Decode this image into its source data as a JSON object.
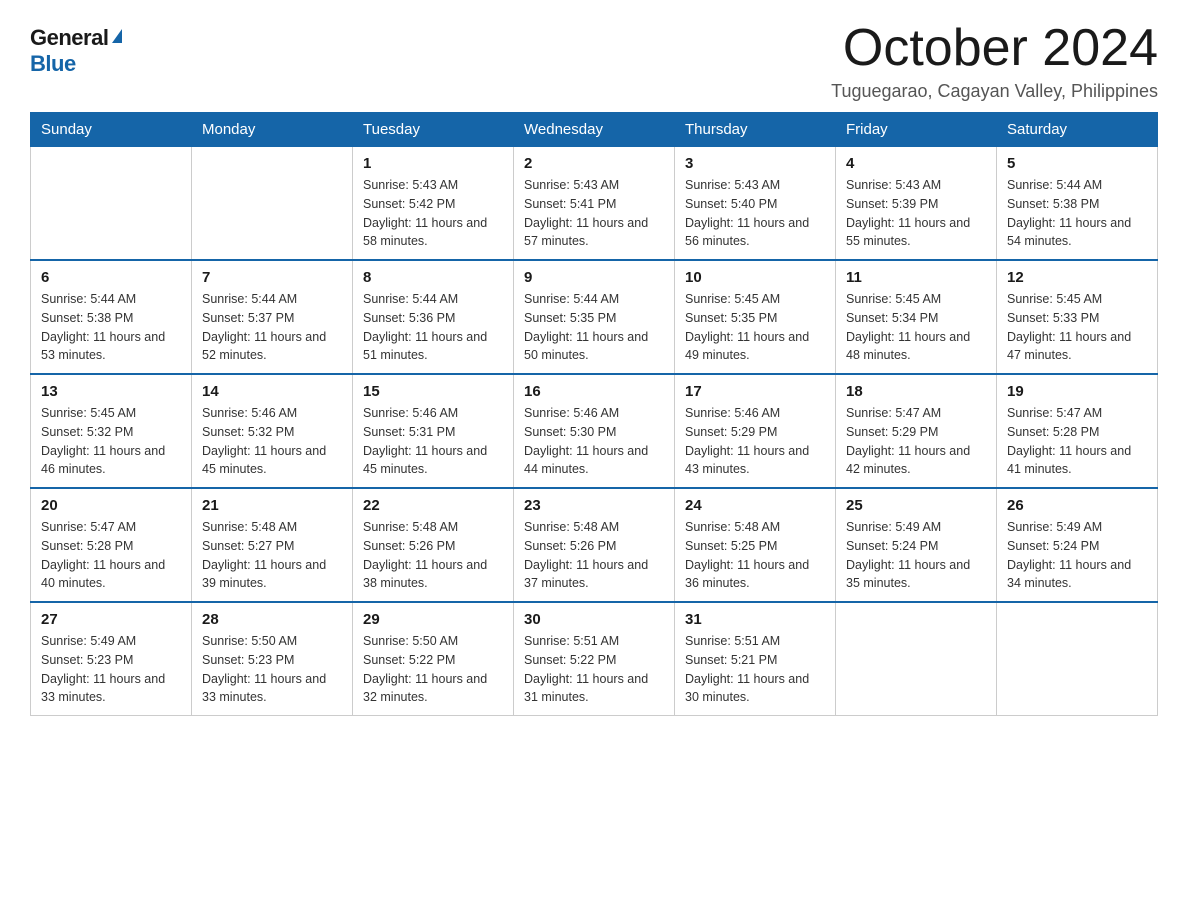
{
  "logo": {
    "general": "General",
    "blue": "Blue"
  },
  "title": "October 2024",
  "location": "Tuguegarao, Cagayan Valley, Philippines",
  "headers": [
    "Sunday",
    "Monday",
    "Tuesday",
    "Wednesday",
    "Thursday",
    "Friday",
    "Saturday"
  ],
  "weeks": [
    [
      {
        "day": "",
        "sunrise": "",
        "sunset": "",
        "daylight": ""
      },
      {
        "day": "",
        "sunrise": "",
        "sunset": "",
        "daylight": ""
      },
      {
        "day": "1",
        "sunrise": "Sunrise: 5:43 AM",
        "sunset": "Sunset: 5:42 PM",
        "daylight": "Daylight: 11 hours and 58 minutes."
      },
      {
        "day": "2",
        "sunrise": "Sunrise: 5:43 AM",
        "sunset": "Sunset: 5:41 PM",
        "daylight": "Daylight: 11 hours and 57 minutes."
      },
      {
        "day": "3",
        "sunrise": "Sunrise: 5:43 AM",
        "sunset": "Sunset: 5:40 PM",
        "daylight": "Daylight: 11 hours and 56 minutes."
      },
      {
        "day": "4",
        "sunrise": "Sunrise: 5:43 AM",
        "sunset": "Sunset: 5:39 PM",
        "daylight": "Daylight: 11 hours and 55 minutes."
      },
      {
        "day": "5",
        "sunrise": "Sunrise: 5:44 AM",
        "sunset": "Sunset: 5:38 PM",
        "daylight": "Daylight: 11 hours and 54 minutes."
      }
    ],
    [
      {
        "day": "6",
        "sunrise": "Sunrise: 5:44 AM",
        "sunset": "Sunset: 5:38 PM",
        "daylight": "Daylight: 11 hours and 53 minutes."
      },
      {
        "day": "7",
        "sunrise": "Sunrise: 5:44 AM",
        "sunset": "Sunset: 5:37 PM",
        "daylight": "Daylight: 11 hours and 52 minutes."
      },
      {
        "day": "8",
        "sunrise": "Sunrise: 5:44 AM",
        "sunset": "Sunset: 5:36 PM",
        "daylight": "Daylight: 11 hours and 51 minutes."
      },
      {
        "day": "9",
        "sunrise": "Sunrise: 5:44 AM",
        "sunset": "Sunset: 5:35 PM",
        "daylight": "Daylight: 11 hours and 50 minutes."
      },
      {
        "day": "10",
        "sunrise": "Sunrise: 5:45 AM",
        "sunset": "Sunset: 5:35 PM",
        "daylight": "Daylight: 11 hours and 49 minutes."
      },
      {
        "day": "11",
        "sunrise": "Sunrise: 5:45 AM",
        "sunset": "Sunset: 5:34 PM",
        "daylight": "Daylight: 11 hours and 48 minutes."
      },
      {
        "day": "12",
        "sunrise": "Sunrise: 5:45 AM",
        "sunset": "Sunset: 5:33 PM",
        "daylight": "Daylight: 11 hours and 47 minutes."
      }
    ],
    [
      {
        "day": "13",
        "sunrise": "Sunrise: 5:45 AM",
        "sunset": "Sunset: 5:32 PM",
        "daylight": "Daylight: 11 hours and 46 minutes."
      },
      {
        "day": "14",
        "sunrise": "Sunrise: 5:46 AM",
        "sunset": "Sunset: 5:32 PM",
        "daylight": "Daylight: 11 hours and 45 minutes."
      },
      {
        "day": "15",
        "sunrise": "Sunrise: 5:46 AM",
        "sunset": "Sunset: 5:31 PM",
        "daylight": "Daylight: 11 hours and 45 minutes."
      },
      {
        "day": "16",
        "sunrise": "Sunrise: 5:46 AM",
        "sunset": "Sunset: 5:30 PM",
        "daylight": "Daylight: 11 hours and 44 minutes."
      },
      {
        "day": "17",
        "sunrise": "Sunrise: 5:46 AM",
        "sunset": "Sunset: 5:29 PM",
        "daylight": "Daylight: 11 hours and 43 minutes."
      },
      {
        "day": "18",
        "sunrise": "Sunrise: 5:47 AM",
        "sunset": "Sunset: 5:29 PM",
        "daylight": "Daylight: 11 hours and 42 minutes."
      },
      {
        "day": "19",
        "sunrise": "Sunrise: 5:47 AM",
        "sunset": "Sunset: 5:28 PM",
        "daylight": "Daylight: 11 hours and 41 minutes."
      }
    ],
    [
      {
        "day": "20",
        "sunrise": "Sunrise: 5:47 AM",
        "sunset": "Sunset: 5:28 PM",
        "daylight": "Daylight: 11 hours and 40 minutes."
      },
      {
        "day": "21",
        "sunrise": "Sunrise: 5:48 AM",
        "sunset": "Sunset: 5:27 PM",
        "daylight": "Daylight: 11 hours and 39 minutes."
      },
      {
        "day": "22",
        "sunrise": "Sunrise: 5:48 AM",
        "sunset": "Sunset: 5:26 PM",
        "daylight": "Daylight: 11 hours and 38 minutes."
      },
      {
        "day": "23",
        "sunrise": "Sunrise: 5:48 AM",
        "sunset": "Sunset: 5:26 PM",
        "daylight": "Daylight: 11 hours and 37 minutes."
      },
      {
        "day": "24",
        "sunrise": "Sunrise: 5:48 AM",
        "sunset": "Sunset: 5:25 PM",
        "daylight": "Daylight: 11 hours and 36 minutes."
      },
      {
        "day": "25",
        "sunrise": "Sunrise: 5:49 AM",
        "sunset": "Sunset: 5:24 PM",
        "daylight": "Daylight: 11 hours and 35 minutes."
      },
      {
        "day": "26",
        "sunrise": "Sunrise: 5:49 AM",
        "sunset": "Sunset: 5:24 PM",
        "daylight": "Daylight: 11 hours and 34 minutes."
      }
    ],
    [
      {
        "day": "27",
        "sunrise": "Sunrise: 5:49 AM",
        "sunset": "Sunset: 5:23 PM",
        "daylight": "Daylight: 11 hours and 33 minutes."
      },
      {
        "day": "28",
        "sunrise": "Sunrise: 5:50 AM",
        "sunset": "Sunset: 5:23 PM",
        "daylight": "Daylight: 11 hours and 33 minutes."
      },
      {
        "day": "29",
        "sunrise": "Sunrise: 5:50 AM",
        "sunset": "Sunset: 5:22 PM",
        "daylight": "Daylight: 11 hours and 32 minutes."
      },
      {
        "day": "30",
        "sunrise": "Sunrise: 5:51 AM",
        "sunset": "Sunset: 5:22 PM",
        "daylight": "Daylight: 11 hours and 31 minutes."
      },
      {
        "day": "31",
        "sunrise": "Sunrise: 5:51 AM",
        "sunset": "Sunset: 5:21 PM",
        "daylight": "Daylight: 11 hours and 30 minutes."
      },
      {
        "day": "",
        "sunrise": "",
        "sunset": "",
        "daylight": ""
      },
      {
        "day": "",
        "sunrise": "",
        "sunset": "",
        "daylight": ""
      }
    ]
  ]
}
